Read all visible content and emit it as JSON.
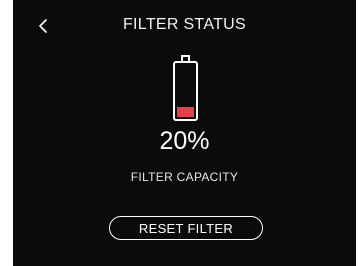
{
  "header": {
    "title": "FILTER STATUS",
    "back_icon": "chevron-left-icon"
  },
  "filter": {
    "battery_icon": "battery-icon",
    "level_percent": 20,
    "level_text": "20%",
    "fill_color": "#e8404a",
    "capacity_label": "FILTER CAPACITY"
  },
  "actions": {
    "reset_label": "RESET FILTER"
  },
  "theme": {
    "background": "#0b0b0b",
    "foreground": "#ffffff"
  }
}
